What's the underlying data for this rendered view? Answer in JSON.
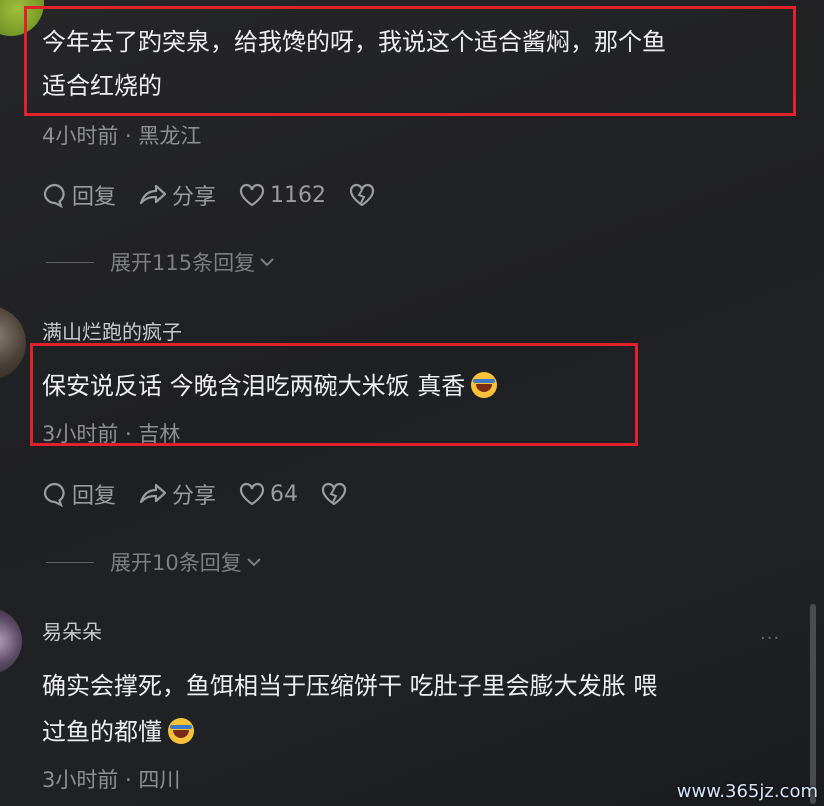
{
  "comments": [
    {
      "text_line1": "今年去了趵突泉，给我馋的呀，我说这个适合酱焖，那个鱼",
      "text_line2": "适合红烧的",
      "meta": "4小时前 · 黑龙江",
      "reply_label": "回复",
      "share_label": "分享",
      "like_count": "1162",
      "expand_label": "展开115条回复"
    },
    {
      "username": "满山烂跑的疯子",
      "text_line1": "保安说反话 今晚含泪吃两碗大米饭 真香",
      "meta": "3小时前 · 吉林",
      "reply_label": "回复",
      "share_label": "分享",
      "like_count": "64",
      "expand_label": "展开10条回复"
    },
    {
      "username": "易朵朵",
      "text_line1": "确实会撑死，鱼饵相当于压缩饼干 吃肚子里会膨大发胀 喂",
      "text_line2": "过鱼的都懂",
      "meta": "3小时前 · 四川"
    }
  ],
  "more_icon": "···",
  "watermark": "www.365jz.com",
  "colors": {
    "highlight_border": "#e1222c",
    "background": "#202226"
  }
}
